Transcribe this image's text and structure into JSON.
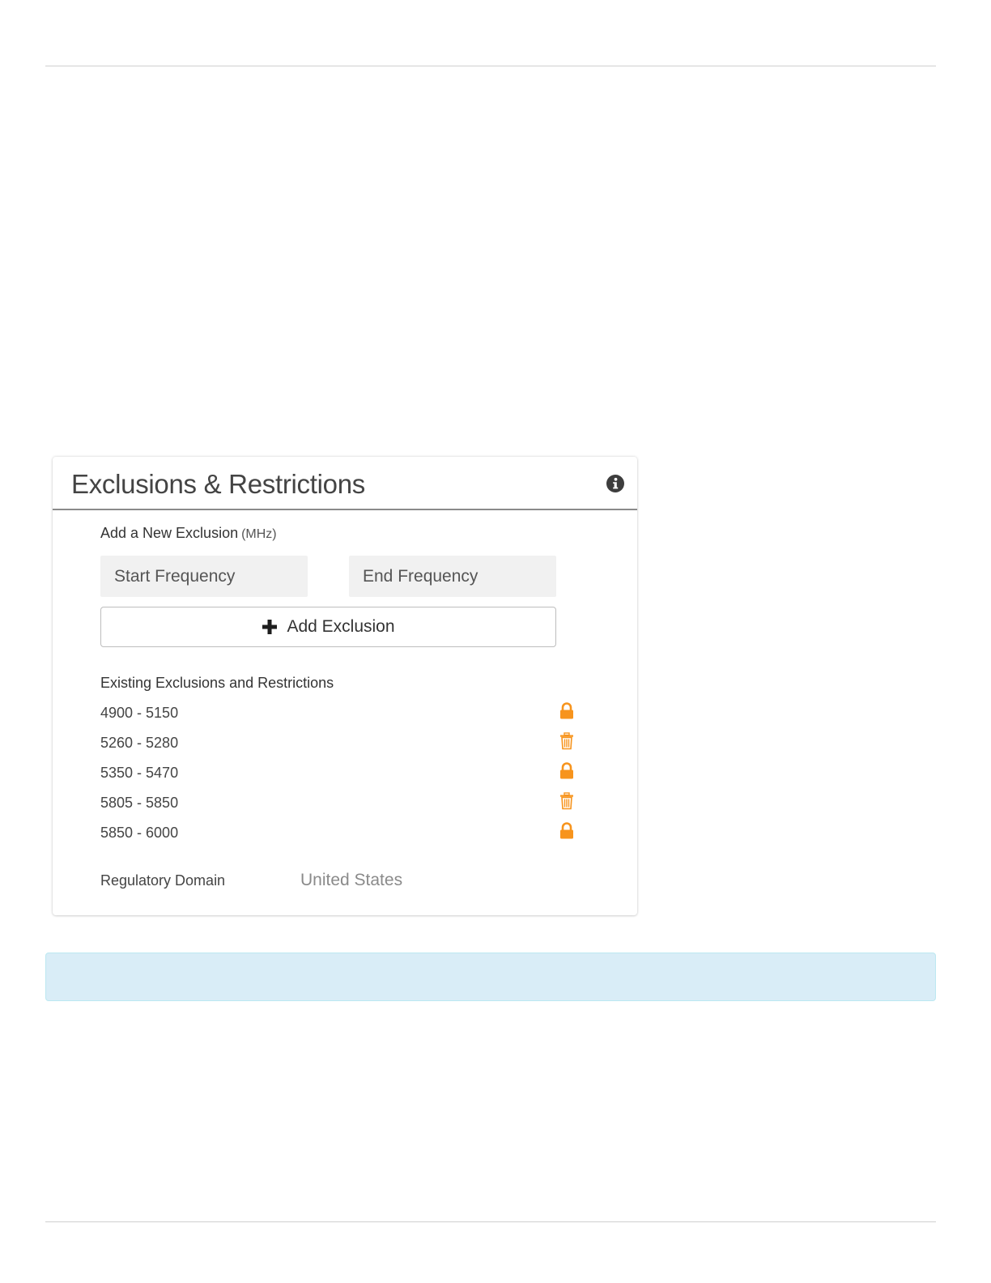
{
  "panel": {
    "title": "Exclusions & Restrictions",
    "info_icon": "info-circle-icon"
  },
  "add_exclusion": {
    "label": "Add a New Exclusion",
    "unit": "(MHz)",
    "start_placeholder": "Start Frequency",
    "start_value": "",
    "end_placeholder": "End Frequency",
    "end_value": "",
    "button_label": "Add Exclusion",
    "button_icon": "plus-icon"
  },
  "existing": {
    "label": "Existing Exclusions and Restrictions",
    "items": [
      {
        "range": "4900 - 5150",
        "icon": "lock-icon",
        "locked": true
      },
      {
        "range": "5260 - 5280",
        "icon": "trash-icon",
        "locked": false
      },
      {
        "range": "5350 - 5470",
        "icon": "lock-icon",
        "locked": true
      },
      {
        "range": "5805 - 5850",
        "icon": "trash-icon",
        "locked": false
      },
      {
        "range": "5850 - 6000",
        "icon": "lock-icon",
        "locked": true
      }
    ]
  },
  "regulatory": {
    "label": "Regulatory Domain",
    "value": "United States"
  },
  "colors": {
    "accent_orange": "#f7941d",
    "alert_bg": "#d9edf7",
    "header_rule": "#8a8a8a"
  }
}
